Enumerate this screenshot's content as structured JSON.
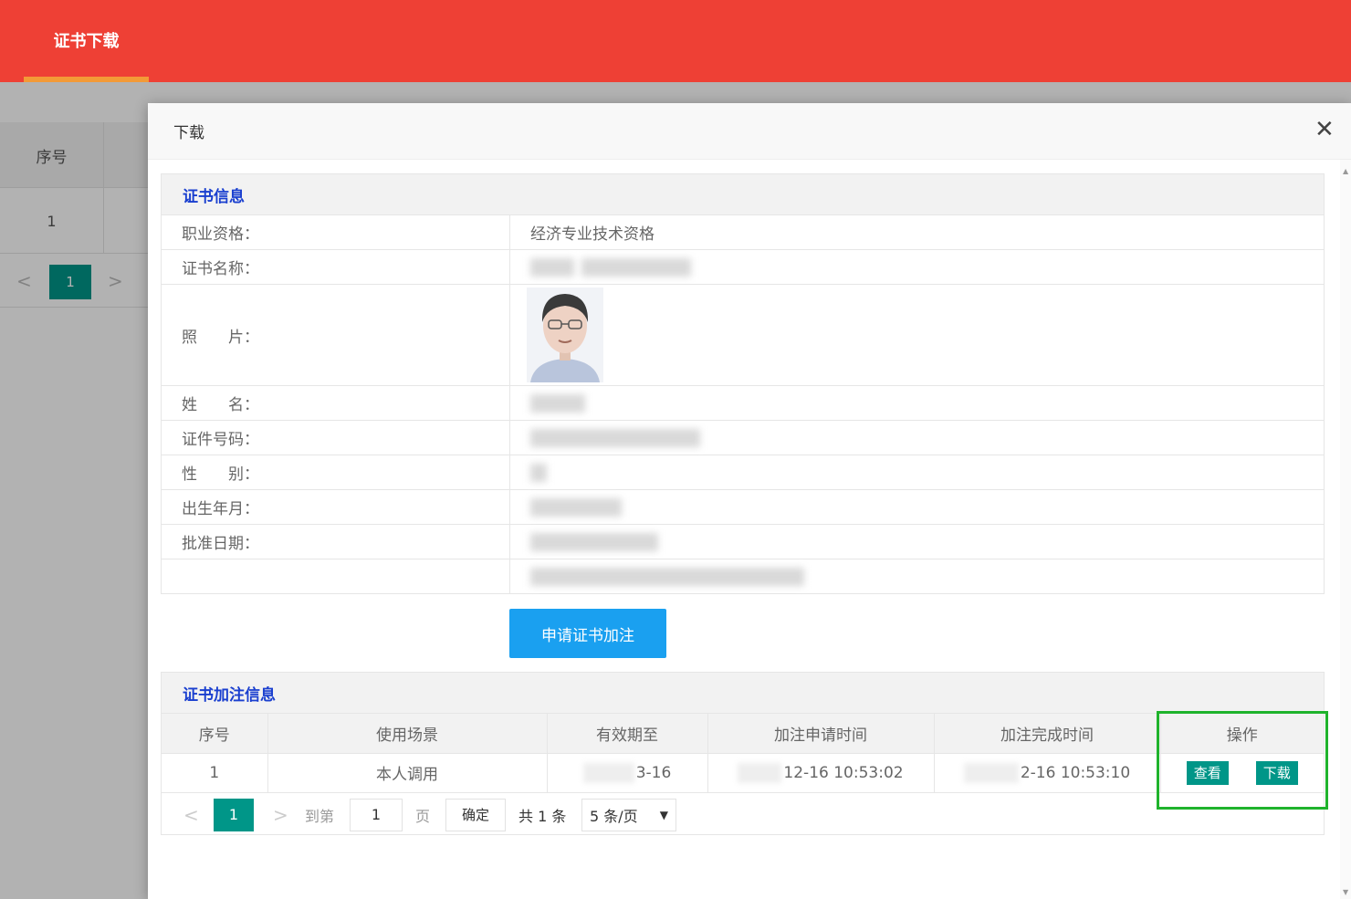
{
  "topbar": {
    "tab_label": "证书下载"
  },
  "background_table": {
    "header": "序号",
    "row_index": "1",
    "pager": {
      "prev": "<",
      "current": "1",
      "next": ">"
    }
  },
  "modal": {
    "title": "下载",
    "close": "✕",
    "cert_section": {
      "heading": "证书信息",
      "rows": [
        {
          "label": "职业资格：",
          "value": "经济专业技术资格"
        },
        {
          "label": "证书名称：",
          "value": ""
        },
        {
          "label": "照　　片：",
          "value": ""
        },
        {
          "label": "姓　　名：",
          "value": ""
        },
        {
          "label": "证件号码：",
          "value": ""
        },
        {
          "label": "性　　别：",
          "value": ""
        },
        {
          "label": "出生年月：",
          "value": ""
        },
        {
          "label": "批准日期：",
          "value": ""
        },
        {
          "label": "",
          "value": ""
        }
      ]
    },
    "apply_button": "申请证书加注",
    "annotation_section": {
      "heading": "证书加注信息",
      "columns": [
        "序号",
        "使用场景",
        "有效期至",
        "加注申请时间",
        "加注完成时间",
        "操作"
      ],
      "rows": [
        {
          "index": "1",
          "scene": "本人调用",
          "valid_until": "3-16",
          "apply_time": "12-16 10:53:02",
          "done_time": "2-16 10:53:10",
          "view": "查看",
          "download": "下载"
        }
      ],
      "pager": {
        "prev": "<",
        "current": "1",
        "next": ">",
        "goto_label": "到第",
        "goto_value": "1",
        "page_label": "页",
        "ok_label": "确定",
        "total": "共 1 条",
        "page_size": "5 条/页"
      }
    }
  },
  "colors": {
    "topbar": "#ee4035",
    "tab_underline": "#f39a37",
    "primary_blue": "#1aa0f0",
    "section_heading": "#1a3fcf",
    "teal": "#009688",
    "highlight": "#1fb32c"
  }
}
